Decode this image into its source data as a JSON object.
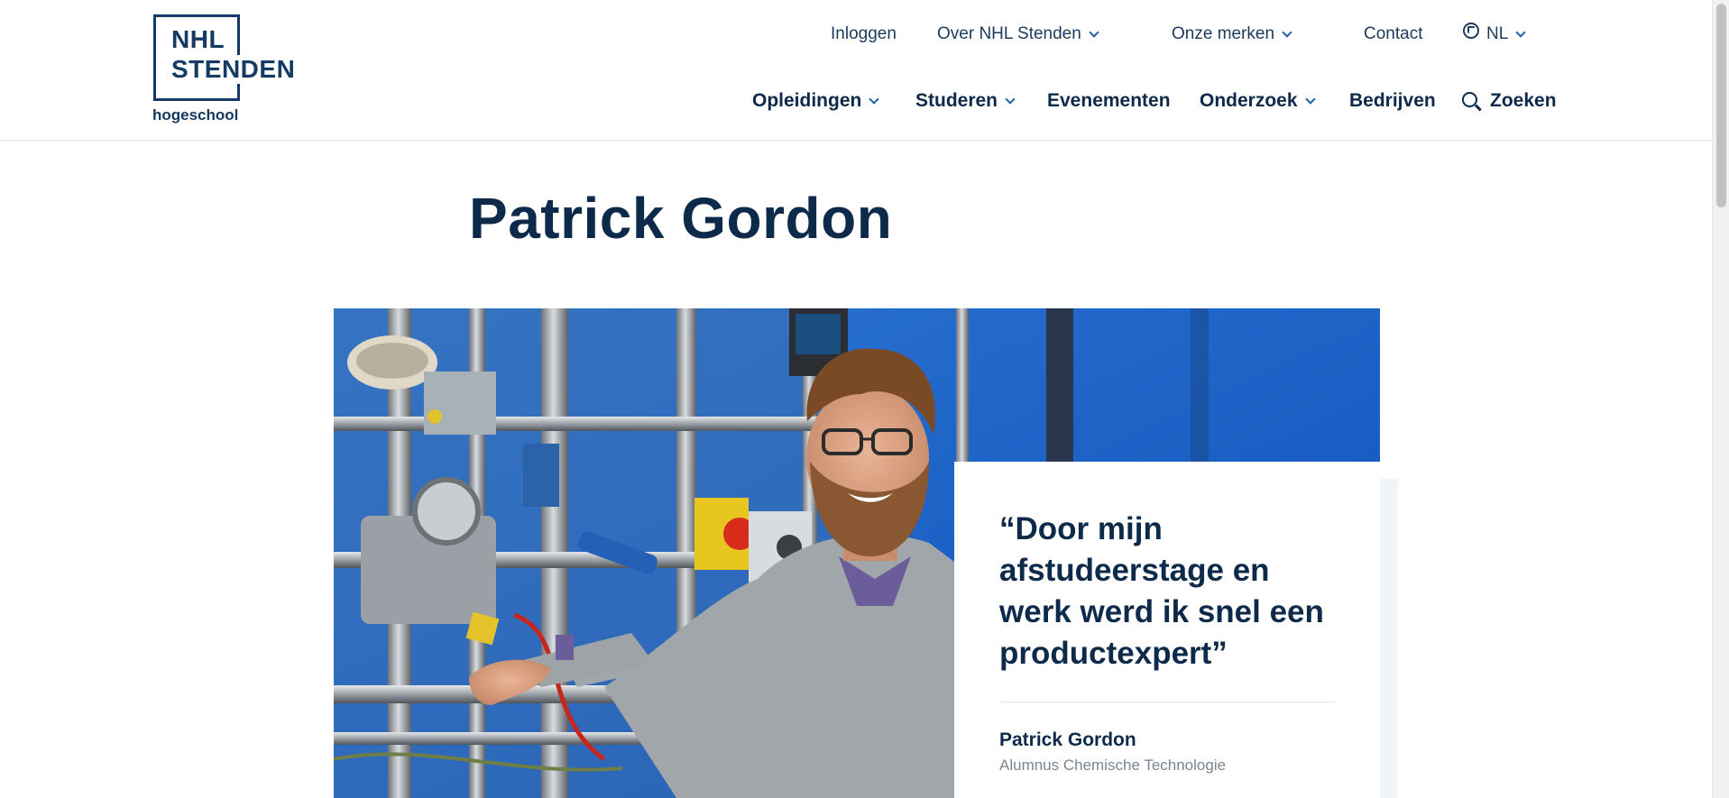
{
  "header": {
    "logo": {
      "line1": "NHL",
      "line2": "STENDEN",
      "subtitle": "hogeschool"
    },
    "topnav": {
      "login": "Inloggen",
      "about": "Over NHL Stenden",
      "brands": "Onze merken",
      "contact": "Contact",
      "language": "NL"
    },
    "mainnav": {
      "programs": "Opleidingen",
      "studying": "Studeren",
      "events": "Evenementen",
      "research": "Onderzoek",
      "companies": "Bedrijven",
      "search": "Zoeken"
    }
  },
  "page": {
    "title": "Patrick Gordon"
  },
  "quote": {
    "text": "“Door mijn afstudeerstage en werk werd ik snel een productexpert”",
    "name": "Patrick Gordon",
    "role": "Alumnus Chemische Technologie"
  },
  "icons": {
    "chevron": "chevron-down-icon",
    "globe": "globe-icon",
    "search": "search-icon"
  },
  "colors": {
    "brand_navy": "#0d2a4a",
    "accent_blue": "#1d5fa8",
    "hero_blue": "#1460c8"
  }
}
